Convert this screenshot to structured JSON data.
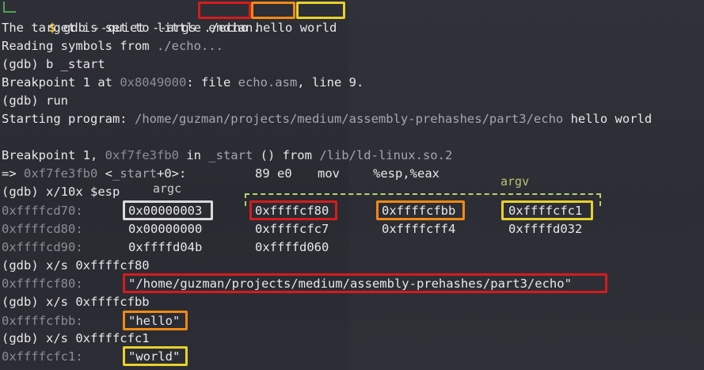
{
  "prompt": {
    "dollar": "$",
    "command": "gdb --quiet --args",
    "arg0": "./echo",
    "arg1": "hello",
    "arg2": "world"
  },
  "lines": {
    "endian": "The target is set to little endian.",
    "reading_prefix": "Reading symbols from ",
    "reading_path": "./echo...",
    "cmd_break": "(gdb) b _start",
    "bp_prefix": "Breakpoint 1 at ",
    "bp_addr": "0x8049000",
    "bp_rest": ": file ",
    "bp_file": "echo.asm",
    "bp_line": ", line 9.",
    "cmd_run": "(gdb) run",
    "start_prefix": "Starting program: ",
    "start_path": "/home/guzman/projects/medium/assembly-prehashes/part3/echo",
    "start_args": " hello world",
    "hit_prefix": "Breakpoint 1, ",
    "hit_addr": "0xf7fe3fb0",
    "hit_in": " in ",
    "hit_func": "_start",
    "hit_from": " () from ",
    "hit_lib": "/lib/ld-linux.so.2",
    "arrow": "=> ",
    "arrow_addr": "0xf7fe3fb0",
    "arrow_sym_open": " <",
    "arrow_sym": "_start",
    "arrow_sym_off": "+0>:",
    "opcode": "89 e0",
    "mnemonic": "mov",
    "operands": "%esp,%eax",
    "cmd_examine": "(gdb) x/10x $esp",
    "label_argc": "argc",
    "label_argv": "argv",
    "cmd_xs1": "(gdb) x/s 0xffffcf80",
    "cmd_xs2": "(gdb) x/s 0xffffcfbb",
    "cmd_xs3": "(gdb) x/s 0xffffcfc1",
    "str1_addr": "0xffffcf80:",
    "str1_val": "\"/home/guzman/projects/medium/assembly-prehashes/part3/echo\"",
    "str2_addr": "0xffffcfbb:",
    "str2_val": "\"hello\"",
    "str3_addr": "0xffffcfc1:",
    "str3_val": "\"world\""
  },
  "memory": [
    {
      "addr": "0xffffcd70:",
      "words": [
        "0x00000003",
        "0xffffcf80",
        "0xffffcfbb",
        "0xffffcfc1"
      ]
    },
    {
      "addr": "0xffffcd80:",
      "words": [
        "0x00000000",
        "0xffffcfc7",
        "0xffffcff4",
        "0xffffd032"
      ]
    },
    {
      "addr": "0xffffcd90:",
      "words": [
        "0xffffd04b",
        "0xffffd060"
      ]
    }
  ],
  "colors": {
    "red_box": "#d41c1c",
    "yellow_box": "#e6d12b",
    "orange_box": "#f08a12",
    "white_box": "#d9d9d9",
    "argv_label": "#b9c46a"
  }
}
